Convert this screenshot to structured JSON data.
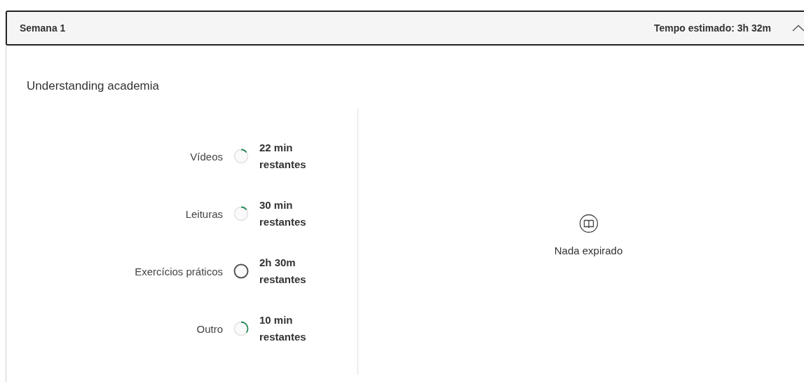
{
  "week": {
    "title": "Semana 1",
    "estimate": "Tempo estimado: 3h 32m",
    "expanded": true
  },
  "module": {
    "title": "Understanding academia"
  },
  "activities": [
    {
      "label": "Vídeos",
      "started": true,
      "remaining": "22 min",
      "suffix": "restantes"
    },
    {
      "label": "Leituras",
      "started": true,
      "remaining": "30 min",
      "suffix": "restantes"
    },
    {
      "label": "Exercícios práticos",
      "started": false,
      "remaining": "2h 30m",
      "suffix": "restantes"
    },
    {
      "label": "Outro",
      "started": true,
      "remaining": "10 min",
      "suffix": "restantes"
    }
  ],
  "expired": {
    "message": "Nada expirado"
  }
}
